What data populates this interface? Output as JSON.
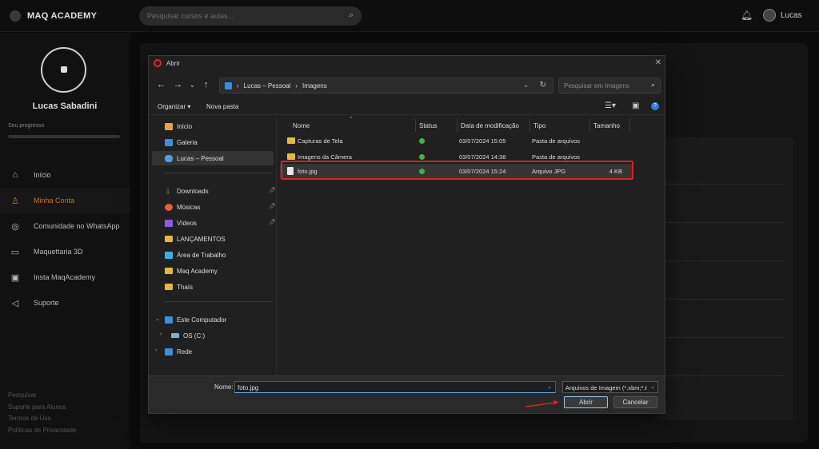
{
  "app": {
    "logo": "MAQ ACADEMY",
    "search_placeholder": "Pesquisar cursos e aulas...",
    "user_name": "Lucas"
  },
  "sidebar": {
    "profile_name": "Lucas Sabadini",
    "progress_label": "Seu progresso",
    "items": [
      {
        "label": "Início",
        "icon": "home-icon",
        "active": false
      },
      {
        "label": "Minha Conta",
        "icon": "user-icon",
        "active": true
      },
      {
        "label": "Comunidade no WhatsApp",
        "icon": "whatsapp-icon",
        "active": false
      },
      {
        "label": "Maquettaria 3D",
        "icon": "printer-icon",
        "active": false
      },
      {
        "label": "Insta MaqAcademy",
        "icon": "instagram-icon",
        "active": false
      },
      {
        "label": "Suporte",
        "icon": "megaphone-icon",
        "active": false
      }
    ],
    "footer_links": [
      "Pesquisar",
      "Suporte para Alunos",
      "Termos de Uso",
      "Políticas de Privacidade"
    ]
  },
  "dialog": {
    "title": "Abrir",
    "breadcrumb": [
      "Lucas – Pessoal",
      "Imagens"
    ],
    "search_placeholder": "Pesquisar em Imagens",
    "toolbar": {
      "organize": "Organizar",
      "new_folder": "Nova pasta"
    },
    "nav_pane": {
      "top": [
        {
          "label": "Início",
          "icon": "home-icon"
        },
        {
          "label": "Galeria",
          "icon": "gallery-icon"
        },
        {
          "label": "Lucas – Pessoal",
          "icon": "onedrive-icon"
        }
      ],
      "quick": [
        {
          "label": "Downloads",
          "icon": "download-icon",
          "pinned": true
        },
        {
          "label": "Músicas",
          "icon": "music-icon",
          "pinned": true
        },
        {
          "label": "Vídeos",
          "icon": "video-icon",
          "pinned": true
        },
        {
          "label": "LANÇAMENTOS",
          "icon": "folder-icon",
          "pinned": false
        },
        {
          "label": "Área de Trabalho",
          "icon": "desktop-icon",
          "pinned": false
        },
        {
          "label": "Maq Academy",
          "icon": "folder-icon",
          "pinned": false
        },
        {
          "label": "Thaís",
          "icon": "folder-icon",
          "pinned": false
        }
      ],
      "computer": {
        "label": "Este Computador",
        "drive": "OS (C:)",
        "network": "Rede"
      }
    },
    "columns": [
      "Nome",
      "Status",
      "Data de modificação",
      "Tipo",
      "Tamanho"
    ],
    "files": [
      {
        "name": "Capturas de Tela",
        "date": "03/07/2024 15:05",
        "type": "Pasta de arquivos",
        "size": "",
        "kind": "folder"
      },
      {
        "name": "Imagens da Câmera",
        "date": "03/07/2024 14:38",
        "type": "Pasta de arquivos",
        "size": "",
        "kind": "folder"
      },
      {
        "name": "foto.jpg",
        "date": "03/07/2024 15:24",
        "type": "Arquivo JPG",
        "size": "4 KB",
        "kind": "file"
      }
    ],
    "filename_label": "Nome:",
    "filename_value": "foto.jpg",
    "filetype": "Arquivos de Imagem (*.xbm;*.t",
    "open_button": "Abrir",
    "cancel_button": "Cancelar"
  },
  "colors": {
    "accent": "#c8741c",
    "highlight": "#e02020",
    "status_ok": "#3fb24a"
  }
}
